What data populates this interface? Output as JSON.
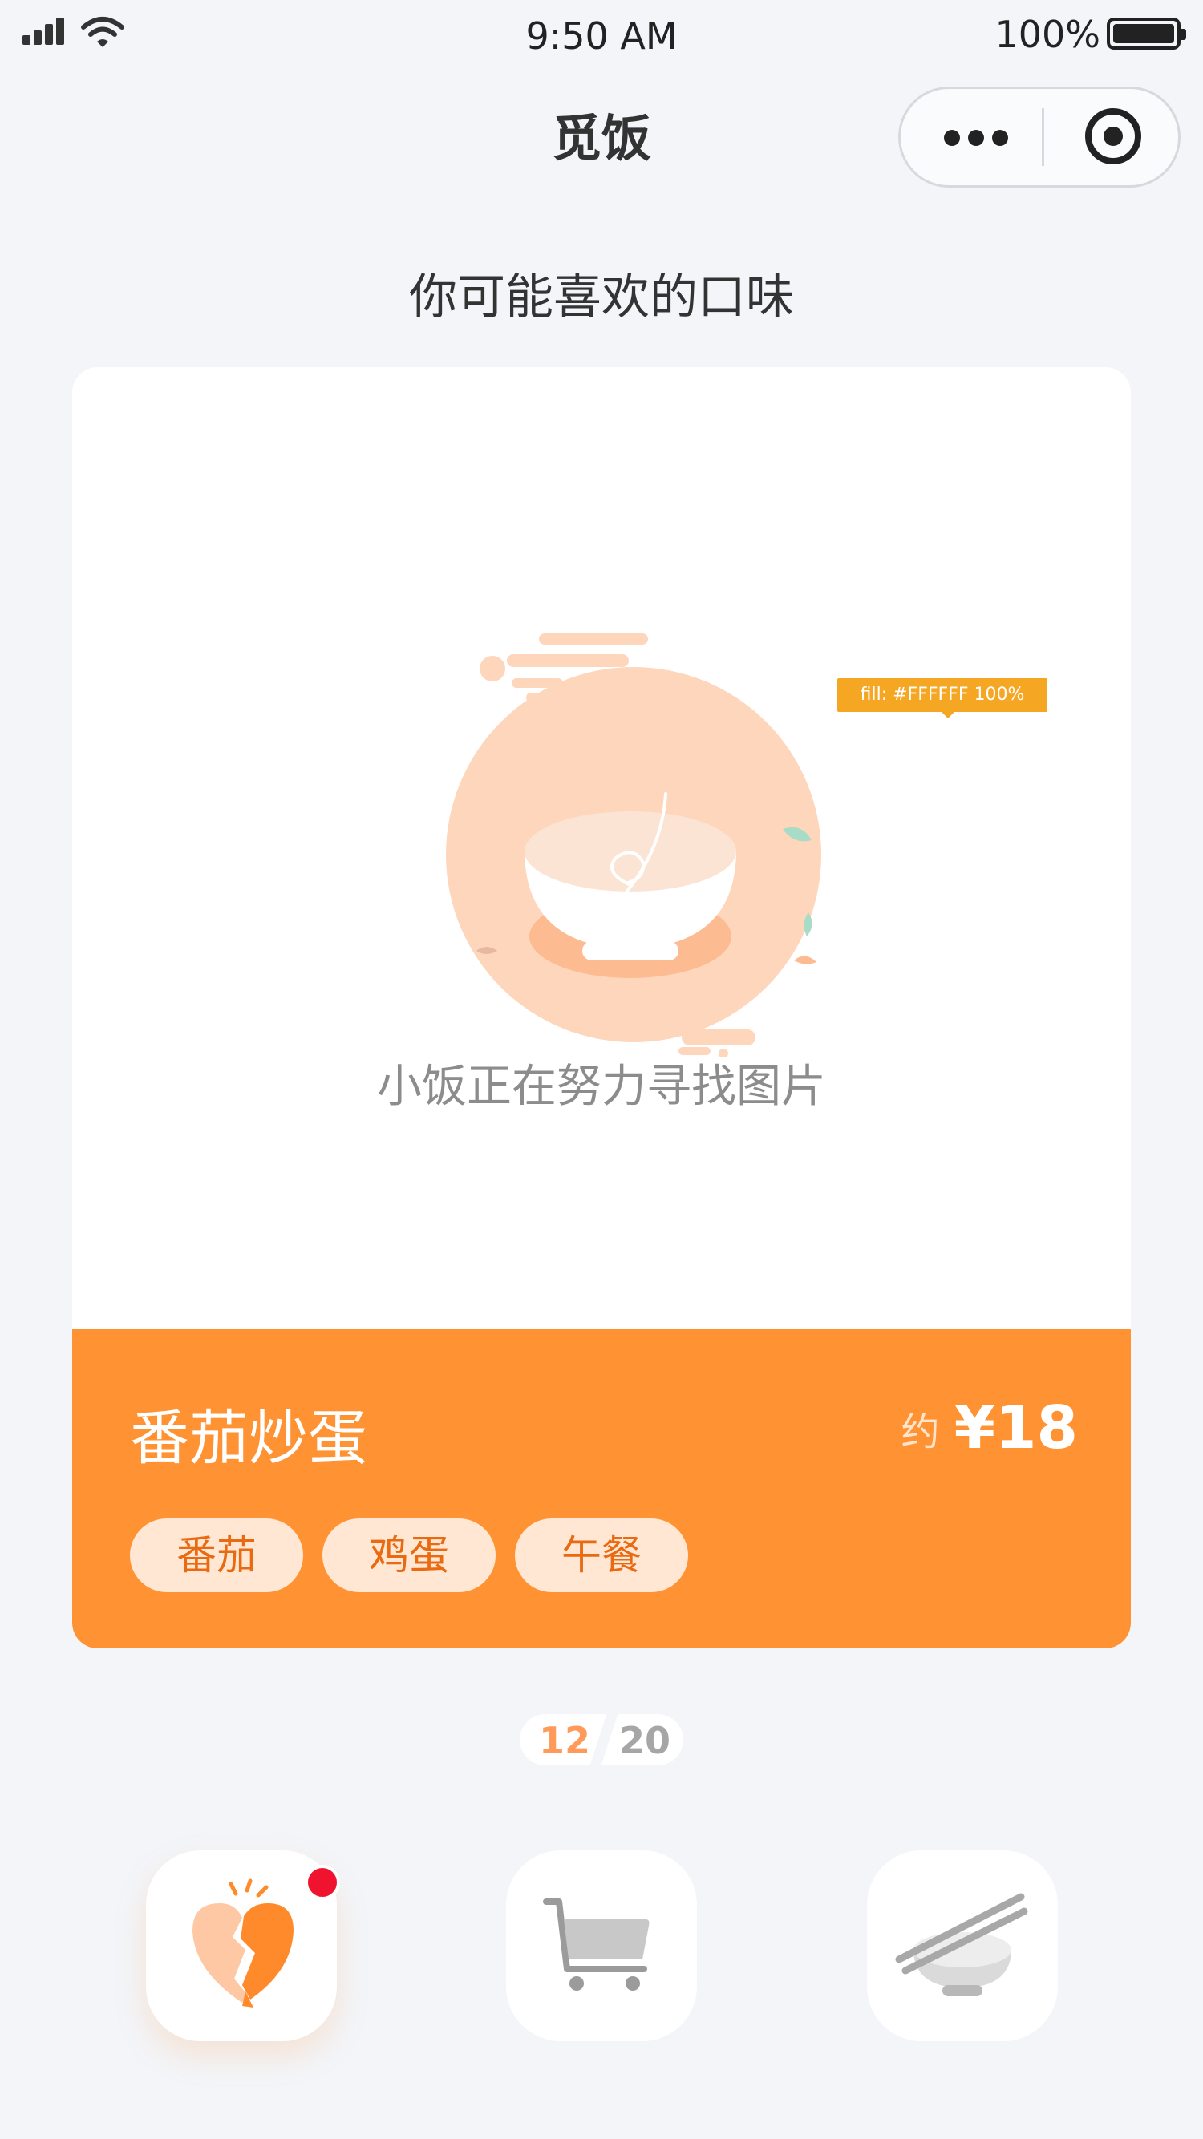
{
  "status_bar": {
    "time": "9:50 AM",
    "battery": "100%"
  },
  "nav": {
    "title": "觅饭"
  },
  "section_title": "你可能喜欢的口味",
  "card": {
    "placeholder_text": "小饭正在努力寻找图片",
    "fill_tip": "fill: #FFFFFF 100%",
    "dish_name": "番茄炒蛋",
    "price_prefix": "约",
    "price": "¥18",
    "tags": [
      "番茄",
      "鸡蛋",
      "午餐"
    ]
  },
  "pager": {
    "current": "12",
    "total": "20"
  },
  "actions": {
    "dislike_icon": "broken-heart-icon",
    "cart_icon": "cart-icon",
    "bowl_icon": "bowl-chopsticks-icon",
    "has_notification": true
  },
  "colors": {
    "accent": "#FF9232",
    "background": "#F3F5F9",
    "tag_bg": "#FFE7D3",
    "tag_text": "#E96A10",
    "badge": "#F0132F",
    "tooltip": "#F5A623"
  }
}
